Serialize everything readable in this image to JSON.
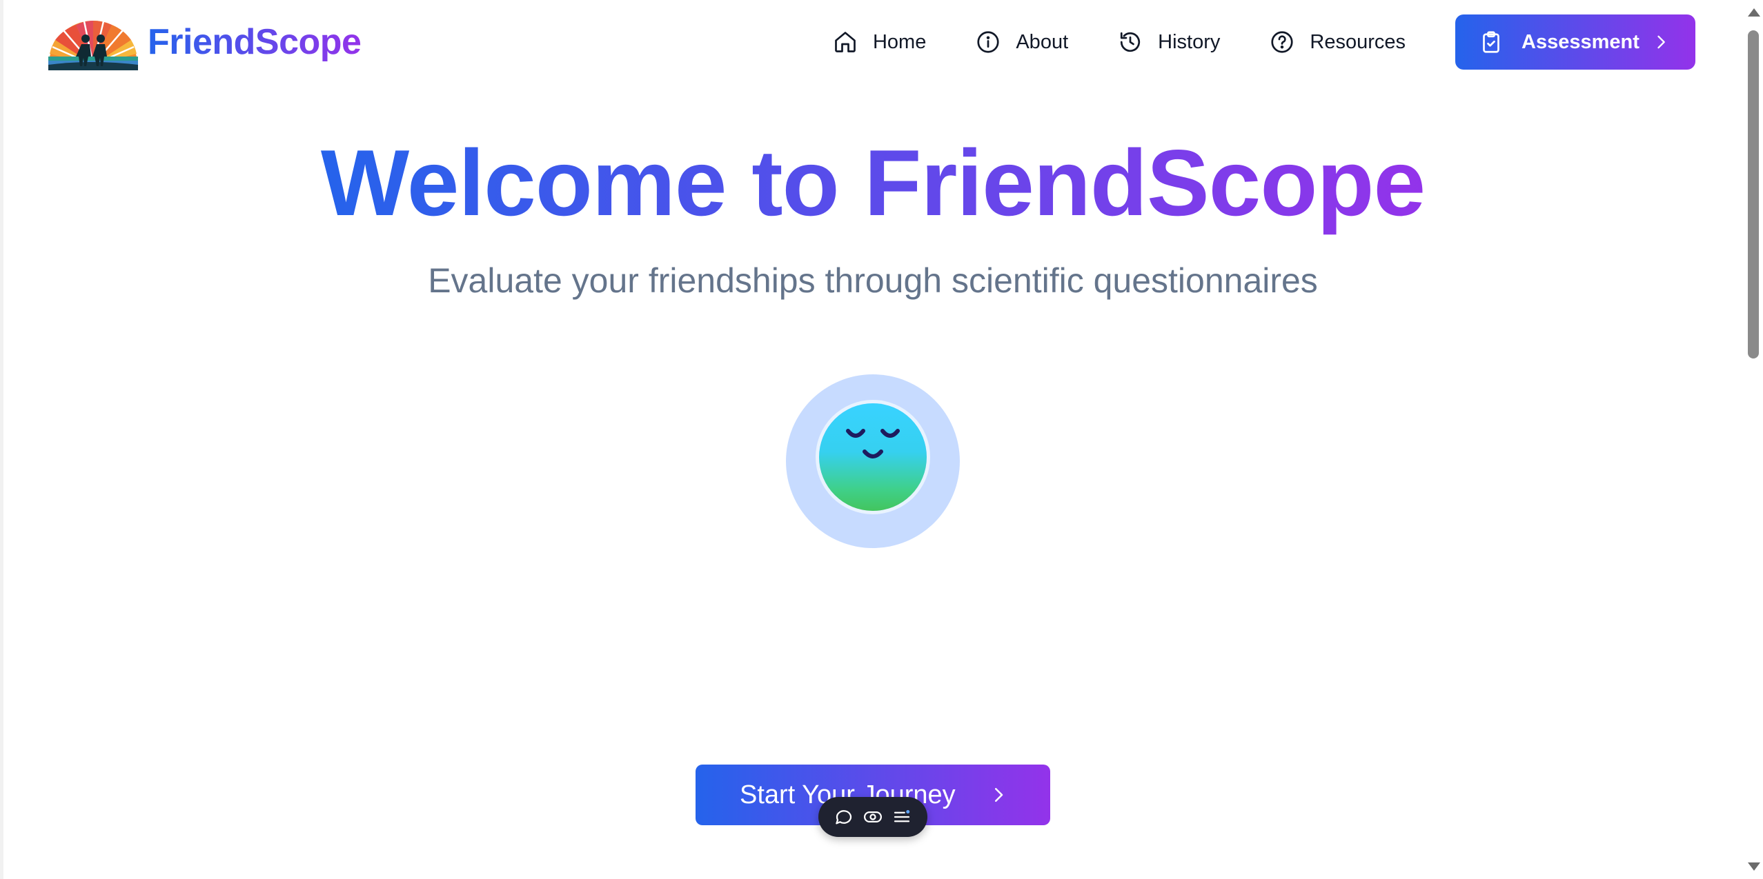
{
  "brand": {
    "name": "FriendScope",
    "logo_icon": "sunrise-friends-logo"
  },
  "nav": {
    "items": [
      {
        "label": "Home",
        "icon": "home-icon"
      },
      {
        "label": "About",
        "icon": "info-icon"
      },
      {
        "label": "History",
        "icon": "history-icon"
      },
      {
        "label": "Resources",
        "icon": "help-circle-icon"
      }
    ],
    "cta": {
      "label": "Assessment",
      "icon": "clipboard-check-icon",
      "trailing_icon": "chevron-right-icon"
    }
  },
  "hero": {
    "title": "Welcome to FriendScope",
    "subtitle": "Evaluate your friendships through scientific questionnaires",
    "mascot": "calm-face-avatar"
  },
  "cta": {
    "label": "Start Your Journey",
    "trailing_icon": "chevron-right-icon"
  },
  "floating_toolbar": {
    "tools": [
      "comment-icon",
      "eye-icon",
      "menu-icon"
    ]
  },
  "colors": {
    "gradient_start": "#2563eb",
    "gradient_end": "#9333ea",
    "subtitle": "#64748b",
    "avatar_ring": "#c7dbff"
  }
}
